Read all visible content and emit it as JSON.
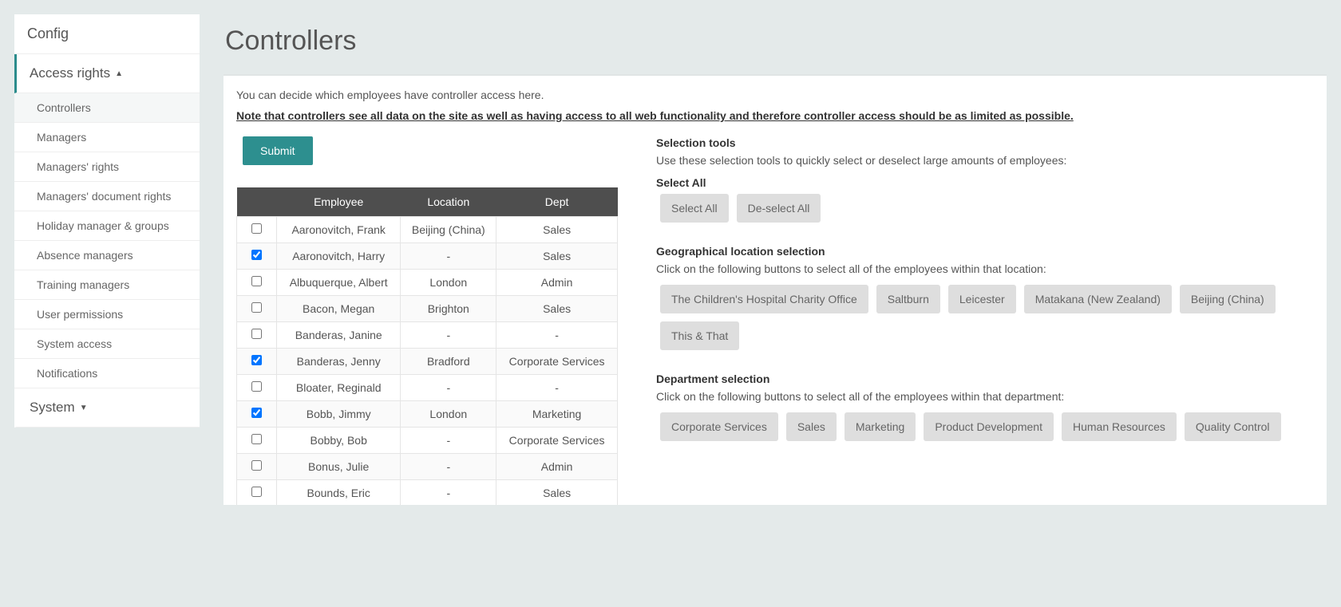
{
  "sidebar": {
    "top": "Config",
    "access_rights": "Access rights",
    "system": "System",
    "items": [
      "Controllers",
      "Managers",
      "Managers' rights",
      "Managers' document rights",
      "Holiday manager & groups",
      "Absence managers",
      "Training managers",
      "User permissions",
      "System access",
      "Notifications"
    ]
  },
  "page_title": "Controllers",
  "intro": "You can decide which employees have controller access here.",
  "note": "Note that controllers see all data on the site as well as having access to all web functionality and therefore controller access should be as limited as possible.",
  "submit": "Submit",
  "table": {
    "headers": {
      "employee": "Employee",
      "location": "Location",
      "dept": "Dept"
    },
    "rows": [
      {
        "checked": false,
        "employee": "Aaronovitch, Frank",
        "location": "Beijing (China)",
        "dept": "Sales"
      },
      {
        "checked": true,
        "employee": "Aaronovitch, Harry",
        "location": "-",
        "dept": "Sales"
      },
      {
        "checked": false,
        "employee": "Albuquerque, Albert",
        "location": "London",
        "dept": "Admin"
      },
      {
        "checked": false,
        "employee": "Bacon, Megan",
        "location": "Brighton",
        "dept": "Sales"
      },
      {
        "checked": false,
        "employee": "Banderas, Janine",
        "location": "-",
        "dept": "-"
      },
      {
        "checked": true,
        "employee": "Banderas, Jenny",
        "location": "Bradford",
        "dept": "Corporate Services"
      },
      {
        "checked": false,
        "employee": "Bloater, Reginald",
        "location": "-",
        "dept": "-"
      },
      {
        "checked": true,
        "employee": "Bobb, Jimmy",
        "location": "London",
        "dept": "Marketing"
      },
      {
        "checked": false,
        "employee": "Bobby, Bob",
        "location": "-",
        "dept": "Corporate Services"
      },
      {
        "checked": false,
        "employee": "Bonus, Julie",
        "location": "-",
        "dept": "Admin"
      },
      {
        "checked": false,
        "employee": "Bounds, Eric",
        "location": "-",
        "dept": "Sales"
      }
    ]
  },
  "selection": {
    "title": "Selection tools",
    "text": "Use these selection tools to quickly select or deselect large amounts of employees:",
    "select_all_label": "Select All",
    "select_all_btn": "Select All",
    "deselect_all_btn": "De-select All"
  },
  "geo": {
    "title": "Geographical location selection",
    "text": "Click on the following buttons to select all of the employees within that location:",
    "buttons": [
      "The Children's Hospital Charity Office",
      "Saltburn",
      "Leicester",
      "Matakana (New Zealand)",
      "Beijing (China)",
      "This & That"
    ]
  },
  "dept": {
    "title": "Department selection",
    "text": "Click on the following buttons to select all of the employees within that department:",
    "buttons": [
      "Corporate Services",
      "Sales",
      "Marketing",
      "Product Development",
      "Human Resources",
      "Quality Control"
    ]
  }
}
